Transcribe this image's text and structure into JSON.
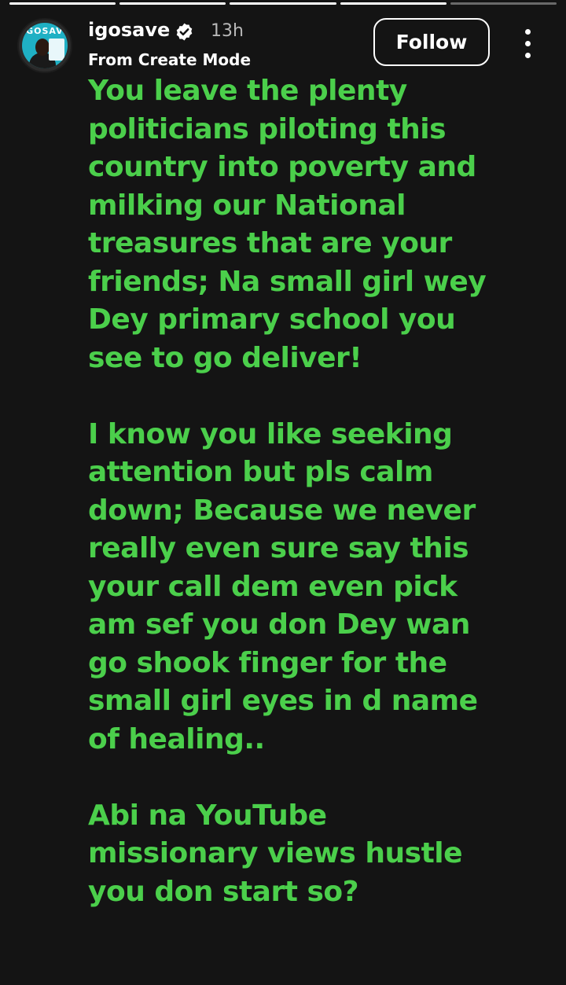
{
  "story_progress": {
    "total_segments": 5,
    "completed_segments": 4
  },
  "header": {
    "username": "igosave",
    "verified": true,
    "time": "13h",
    "subtitle": "From Create Mode",
    "follow_label": "Follow",
    "avatar_text": "IGOSAVE"
  },
  "story": {
    "text_color": "#4bcf4b",
    "background_color": "#141414",
    "paragraphs": [
      "You leave the plenty\npoliticians piloting this\ncountry into poverty and\nmilking our National\ntreasures that are your\nfriends; Na small girl wey\nDey primary school you\nsee to go deliver!",
      "I know you like seeking\nattention but pls calm\ndown; Because we never\nreally even sure say this\nyour call dem even pick\nam sef you don Dey wan\ngo shook finger for the\nsmall girl eyes in d name\nof healing..",
      "Abi na YouTube\nmissionary views hustle\nyou don start so?"
    ]
  }
}
